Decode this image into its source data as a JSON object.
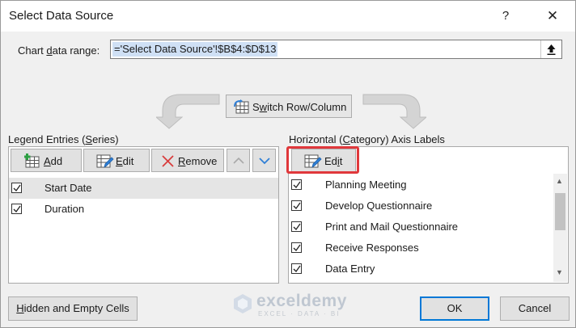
{
  "window": {
    "title": "Select Data Source",
    "help_glyph": "?",
    "close_glyph": "✕"
  },
  "data_range": {
    "label_pre": "Chart ",
    "label_underlined": "d",
    "label_post": "ata range:",
    "value": "='Select Data Source'!$B$4:$D$13",
    "collapse_icon": "collapse-arrow-icon"
  },
  "switch": {
    "label_pre": "S",
    "label_underlined": "w",
    "label_post": "itch Row/Column",
    "icon": "switch-row-column-icon"
  },
  "legend": {
    "label_pre": "Legend Entries (",
    "label_underlined": "S",
    "label_post": "eries)",
    "add_pre": "",
    "add_underlined": "A",
    "add_post": "dd",
    "edit_pre": "",
    "edit_underlined": "E",
    "edit_post": "dit",
    "remove_pre": "",
    "remove_underlined": "R",
    "remove_post": "emove",
    "items": [
      {
        "label": "Start Date",
        "checked": true,
        "selected": true
      },
      {
        "label": "Duration",
        "checked": true,
        "selected": false
      }
    ]
  },
  "axis": {
    "label_pre": "Horizontal (",
    "label_underlined": "C",
    "label_post": "ategory) Axis Labels",
    "edit_pre": "Ed",
    "edit_underlined": "i",
    "edit_post": "t",
    "items": [
      {
        "label": "Planning Meeting",
        "checked": true
      },
      {
        "label": "Develop Questionnaire",
        "checked": true
      },
      {
        "label": "Print and Mail Questionnaire",
        "checked": true
      },
      {
        "label": "Receive Responses",
        "checked": true
      },
      {
        "label": "Data Entry",
        "checked": true
      }
    ]
  },
  "footer": {
    "hidden_pre": "",
    "hidden_underlined": "H",
    "hidden_post": "idden and Empty Cells",
    "ok_label": "OK",
    "cancel_label": "Cancel"
  },
  "watermark": {
    "name": "exceldemy",
    "tagline": "EXCEL · DATA · BI"
  },
  "colors": {
    "highlight": "#e0383b",
    "selection": "#cfe0f5",
    "ok_border": "#0078d7"
  }
}
